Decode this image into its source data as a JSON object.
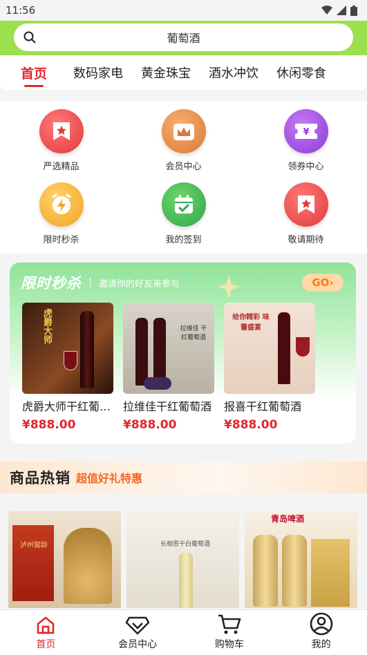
{
  "status": {
    "time": "11:56"
  },
  "search": {
    "placeholder": "葡萄酒"
  },
  "tabs": [
    {
      "label": "首页",
      "active": true
    },
    {
      "label": "数码家电"
    },
    {
      "label": "黄金珠宝"
    },
    {
      "label": "酒水冲饮"
    },
    {
      "label": "休闲零食"
    }
  ],
  "shortcuts": [
    {
      "label": "严选精品",
      "icon": "bookmark-star-icon",
      "color": "#e23838"
    },
    {
      "label": "会员中心",
      "icon": "crown-icon",
      "color": "#d9783a"
    },
    {
      "label": "领券中心",
      "icon": "coupon-yen-icon",
      "color": "#8b3ad6"
    },
    {
      "label": "限时秒杀",
      "icon": "lightning-clock-icon",
      "color": "#f3a221"
    },
    {
      "label": "我的签到",
      "icon": "calendar-check-icon",
      "color": "#2fa74a"
    },
    {
      "label": "敬请期待",
      "icon": "bookmark-star-icon",
      "color": "#e23838"
    }
  ],
  "flash_sale": {
    "title": "限时秒杀",
    "subtitle": "邀请你的好友来参与",
    "go_label": "GO",
    "products": [
      {
        "name": "虎爵大师干红葡萄酒",
        "price": "¥888.00",
        "img_text": "虎爵大师"
      },
      {
        "name": "拉维佳干红葡萄酒",
        "price": "¥888.00",
        "img_text": "拉维佳 干红葡萄酒"
      },
      {
        "name": "报喜干红葡萄酒",
        "price": "¥888.00",
        "img_text": "给你精彩 味蕾盛宴"
      }
    ]
  },
  "hot": {
    "title": "商品热销",
    "subtitle": "超值好礼特惠",
    "products": [
      {
        "img_text": "泸州窖龄"
      },
      {
        "img_text": "长相思干白葡萄酒"
      },
      {
        "img_text": "青岛啤酒"
      }
    ]
  },
  "nav": [
    {
      "label": "首页",
      "icon": "home-icon",
      "active": true
    },
    {
      "label": "会员中心",
      "icon": "diamond-icon"
    },
    {
      "label": "购物车",
      "icon": "cart-icon"
    },
    {
      "label": "我的",
      "icon": "user-icon"
    }
  ]
}
